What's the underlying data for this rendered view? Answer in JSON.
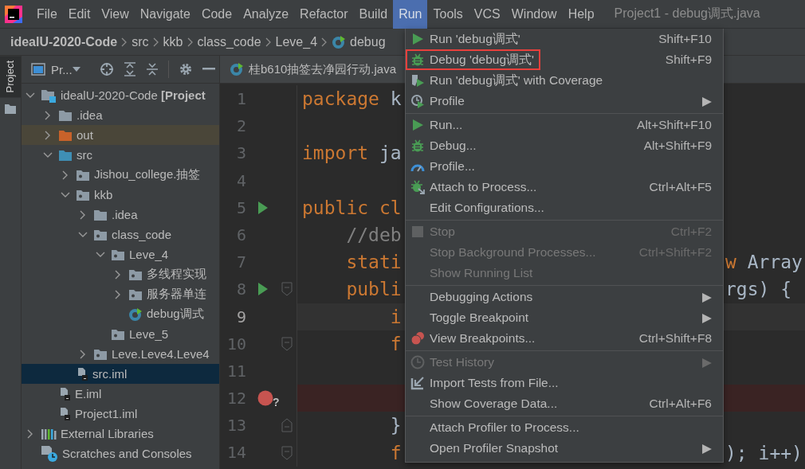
{
  "menu_bar": {
    "items": [
      {
        "label": "File",
        "selected": false
      },
      {
        "label": "Edit",
        "selected": false
      },
      {
        "label": "View",
        "selected": false
      },
      {
        "label": "Navigate",
        "selected": false
      },
      {
        "label": "Code",
        "selected": false
      },
      {
        "label": "Analyze",
        "selected": false
      },
      {
        "label": "Refactor",
        "selected": false
      },
      {
        "label": "Build",
        "selected": false
      },
      {
        "label": "Run",
        "selected": true
      },
      {
        "label": "Tools",
        "selected": false
      },
      {
        "label": "VCS",
        "selected": false
      },
      {
        "label": "Window",
        "selected": false
      },
      {
        "label": "Help",
        "selected": false
      }
    ],
    "title": "Project1 - debug调式.java"
  },
  "breadcrumbs": [
    {
      "label": "idealU-2020-Code",
      "kind": "project"
    },
    {
      "label": "src",
      "kind": "dir"
    },
    {
      "label": "kkb",
      "kind": "dir"
    },
    {
      "label": "class_code",
      "kind": "dir"
    },
    {
      "label": "Leve_4",
      "kind": "dir"
    },
    {
      "label": "debug",
      "kind": "class"
    }
  ],
  "side_tabs": [
    {
      "label": "Project",
      "selected": true
    }
  ],
  "project_panel": {
    "title": "Pr...",
    "tree": [
      {
        "label": "idealU-2020-Code **[Project**",
        "kind": "module",
        "expanded": true,
        "selected": false,
        "children": [
          {
            "label": ".idea",
            "kind": "folder",
            "expanded": false,
            "selected": false
          },
          {
            "label": "out",
            "kind": "excluded",
            "expanded": false,
            "selected": false
          },
          {
            "label": "src",
            "kind": "source",
            "expanded": true,
            "selected": false,
            "children": [
              {
                "label": "Jishou_college.抽签",
                "kind": "package",
                "expanded": false,
                "selected": false
              },
              {
                "label": "kkb",
                "kind": "package",
                "expanded": true,
                "selected": false,
                "children": [
                  {
                    "label": ".idea",
                    "kind": "folder",
                    "expanded": false,
                    "selected": false
                  },
                  {
                    "label": "class_code",
                    "kind": "package",
                    "expanded": true,
                    "selected": false,
                    "children": [
                      {
                        "label": "Leve_4",
                        "kind": "package",
                        "expanded": true,
                        "selected": false,
                        "children": [
                          {
                            "label": "多线程实现",
                            "kind": "package",
                            "expanded": false,
                            "selected": false
                          },
                          {
                            "label": "服务器单连",
                            "kind": "package",
                            "expanded": false,
                            "selected": false
                          },
                          {
                            "label": "debug调式",
                            "kind": "class",
                            "selected": false
                          }
                        ]
                      },
                      {
                        "label": "Leve_5",
                        "kind": "package",
                        "selected": false
                      }
                    ]
                  },
                  {
                    "label": "Leve.Leve4.Leve4",
                    "kind": "package",
                    "expanded": false,
                    "selected": false
                  }
                ]
              },
              {
                "label": "src.iml",
                "kind": "iml",
                "selected": true
              }
            ]
          },
          {
            "label": "E.iml",
            "kind": "iml",
            "selected": false
          },
          {
            "label": "Project1.iml",
            "kind": "iml",
            "selected": false
          }
        ]
      },
      {
        "label": "External Libraries",
        "kind": "libraries",
        "expanded": false,
        "selected": false
      },
      {
        "label": "Scratches and Consoles",
        "kind": "scratches",
        "selected": false
      }
    ]
  },
  "editor": {
    "tabs": [
      {
        "label": "桂b610抽签去净园行动.java",
        "selected": true
      }
    ],
    "lines": [
      {
        "number": "1",
        "kind": "plain",
        "tokens": [
          {
            "text": "package",
            "kind": "keyword"
          },
          {
            "text": " k",
            "kind": "plain"
          }
        ]
      },
      {
        "number": "2",
        "kind": "plain"
      },
      {
        "number": "3",
        "kind": "plain",
        "tokens": [
          {
            "text": "import",
            "kind": "keyword"
          },
          {
            "text": " ja",
            "kind": "plain"
          }
        ]
      },
      {
        "number": "4",
        "kind": "plain"
      },
      {
        "number": "5",
        "kind": "plain",
        "gutter": [
          {
            "kind": "run"
          }
        ],
        "tokens": [
          {
            "text": "public cl",
            "kind": "keyword"
          }
        ]
      },
      {
        "number": "6",
        "kind": "plain",
        "tokens": [
          {
            "text": "    //deb",
            "kind": "comment"
          }
        ]
      },
      {
        "number": "7",
        "kind": "plain",
        "tokens": [
          {
            "text": "    stati",
            "kind": "keyword"
          }
        ],
        "right": [
          {
            "text": "w",
            "kind": "keyword"
          },
          {
            "text": " Array",
            "kind": "plain"
          }
        ]
      },
      {
        "number": "8",
        "kind": "plain",
        "gutter": [
          {
            "kind": "run"
          },
          {
            "kind": "fold-open"
          }
        ],
        "tokens": [
          {
            "text": "    publi",
            "kind": "keyword"
          }
        ],
        "right": [
          {
            "text": "rgs) {",
            "kind": "plain"
          }
        ]
      },
      {
        "number": "9",
        "kind": "current",
        "tokens": [
          {
            "text": "        i",
            "kind": "keyword"
          }
        ]
      },
      {
        "number": "10",
        "kind": "plain",
        "gutter": [
          {
            "kind": "fold-open"
          }
        ],
        "tokens": [
          {
            "text": "        f",
            "kind": "keyword"
          }
        ]
      },
      {
        "number": "11",
        "kind": "plain"
      },
      {
        "number": "12",
        "kind": "breakpoint",
        "gutter": [
          {
            "kind": "breakpoint",
            "label": "?"
          }
        ]
      },
      {
        "number": "13",
        "kind": "plain",
        "gutter": [
          {
            "kind": "fold-close"
          }
        ],
        "tokens": [
          {
            "text": "        }",
            "kind": "plain"
          }
        ]
      },
      {
        "number": "14",
        "kind": "plain",
        "gutter": [
          {
            "kind": "fold-open"
          }
        ],
        "tokens": [
          {
            "text": "        f",
            "kind": "keyword"
          }
        ],
        "right": [
          {
            "text": "); i++)",
            "kind": "plain"
          }
        ]
      }
    ]
  },
  "run_menu": {
    "items": [
      {
        "kind": "run",
        "label": "Run 'debug调式'",
        "shortcut": "Shift+F10",
        "disabled": false,
        "selected": false
      },
      {
        "kind": "debug",
        "label": "Debug 'debug调式'",
        "shortcut": "Shift+F9",
        "disabled": false,
        "selected": true
      },
      {
        "kind": "coverage",
        "label": "Run 'debug调式' with Coverage",
        "disabled": false,
        "selected": false
      },
      {
        "kind": "profile",
        "label": "Profile",
        "shortcut": "▶",
        "disabled": false,
        "selected": false
      },
      {
        "kind": "separator"
      },
      {
        "kind": "run",
        "label": "Run...",
        "shortcut": "Alt+Shift+F10",
        "disabled": false,
        "selected": false
      },
      {
        "kind": "debug",
        "label": "Debug...",
        "shortcut": "Alt+Shift+F9",
        "disabled": false,
        "selected": false
      },
      {
        "kind": "gauge",
        "label": "Profile...",
        "disabled": false,
        "selected": false
      },
      {
        "kind": "attach",
        "label": "Attach to Process...",
        "shortcut": "Ctrl+Alt+F5",
        "disabled": false,
        "selected": false
      },
      {
        "kind": "plain",
        "label": "Edit Configurations...",
        "disabled": false,
        "selected": false
      },
      {
        "kind": "separator"
      },
      {
        "kind": "stop",
        "label": "Stop",
        "shortcut": "Ctrl+F2",
        "disabled": true,
        "selected": false
      },
      {
        "kind": "plain",
        "label": "Stop Background Processes...",
        "shortcut": "Ctrl+Shift+F2",
        "disabled": true,
        "selected": false
      },
      {
        "kind": "plain",
        "label": "Show Running List",
        "disabled": true,
        "selected": false
      },
      {
        "kind": "separator"
      },
      {
        "kind": "plain",
        "label": "Debugging Actions",
        "shortcut": "▶",
        "disabled": false,
        "selected": false
      },
      {
        "kind": "plain",
        "label": "Toggle Breakpoint",
        "shortcut": "▶",
        "disabled": false,
        "selected": false
      },
      {
        "kind": "breakpoints",
        "label": "View Breakpoints...",
        "shortcut": "Ctrl+Shift+F8",
        "disabled": false,
        "selected": false
      },
      {
        "kind": "separator"
      },
      {
        "kind": "history",
        "label": "Test History",
        "shortcut": "▶",
        "disabled": true,
        "selected": false
      },
      {
        "kind": "import",
        "label": "Import Tests from File...",
        "disabled": false,
        "selected": false
      },
      {
        "kind": "plain",
        "label": "Show Coverage Data...",
        "shortcut": "Ctrl+Alt+F6",
        "disabled": false,
        "selected": false
      },
      {
        "kind": "separator"
      },
      {
        "kind": "plain",
        "label": "Attach Profiler to Process...",
        "disabled": false,
        "selected": false
      },
      {
        "kind": "plain",
        "label": "Open Profiler Snapshot",
        "shortcut": "▶",
        "disabled": false,
        "selected": false
      }
    ]
  }
}
